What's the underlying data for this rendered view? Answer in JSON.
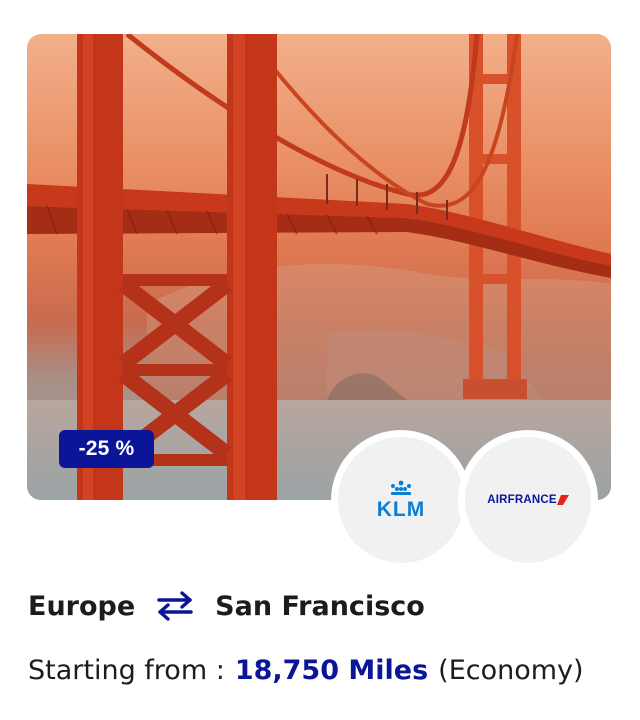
{
  "deal": {
    "discount_label": "-25 %",
    "image_alt": "Golden Gate Bridge, San Francisco",
    "origin": "Europe",
    "destination": "San Francisco",
    "route_icon": "swap-arrows-icon",
    "price_prefix": "Starting from :",
    "price_value": "18,750 Miles",
    "cabin": "(Economy)"
  },
  "airlines": [
    {
      "name": "KLM",
      "logo_text": "KLM",
      "color": "#0a7fd6"
    },
    {
      "name": "Air France",
      "logo_text": "AIRFRANCE",
      "color": "#0a1697",
      "accent": "#e1241b"
    }
  ],
  "colors": {
    "accent": "#0a1697",
    "text": "#1c1c1c",
    "logo_bg": "#f1f1f2"
  }
}
